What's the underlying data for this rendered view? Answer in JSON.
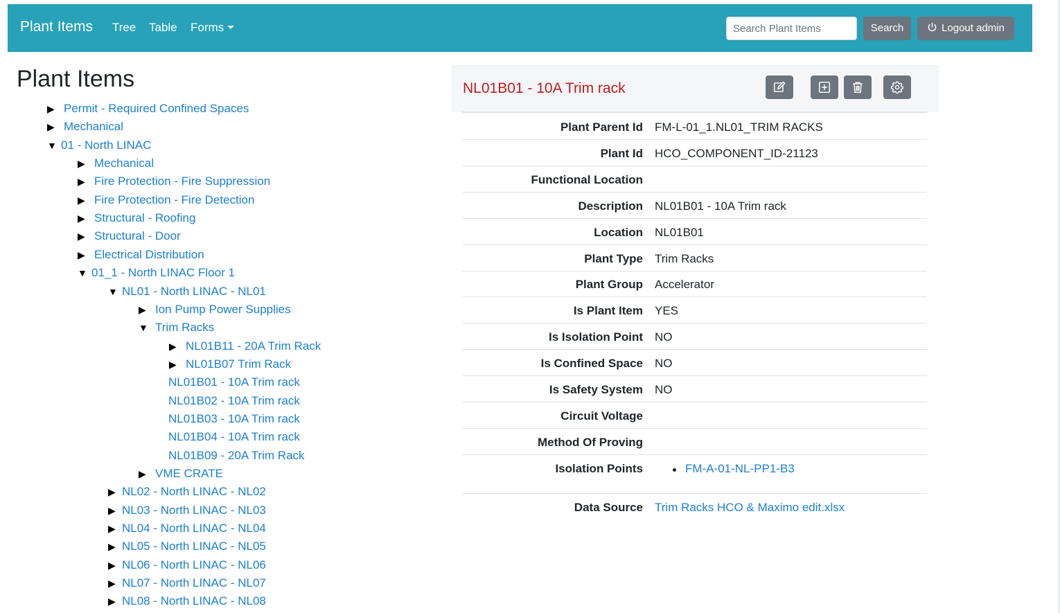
{
  "navbar": {
    "brand": "Plant Items",
    "links": [
      "Tree",
      "Table",
      "Forms"
    ],
    "search_placeholder": "Search Plant Items",
    "search_button": "Search",
    "logout_button": "Logout admin",
    "color": "#27a2b8"
  },
  "page_title": "Plant Items",
  "tree": {
    "items": [
      {
        "label": "Permit - Required Confined Spaces",
        "level": 0,
        "state": "collapsed"
      },
      {
        "label": "Mechanical",
        "level": 0,
        "state": "collapsed"
      },
      {
        "label": "01 - North LINAC",
        "level": 0,
        "state": "expanded"
      },
      {
        "label": "Mechanical",
        "level": 1,
        "state": "collapsed"
      },
      {
        "label": "Fire Protection - Fire Suppression",
        "level": 1,
        "state": "collapsed"
      },
      {
        "label": "Fire Protection - Fire Detection",
        "level": 1,
        "state": "collapsed"
      },
      {
        "label": "Structural - Roofing",
        "level": 1,
        "state": "collapsed"
      },
      {
        "label": "Structural - Door",
        "level": 1,
        "state": "collapsed"
      },
      {
        "label": "Electrical Distribution",
        "level": 1,
        "state": "collapsed"
      },
      {
        "label": "01_1 - North LINAC Floor 1",
        "level": 1,
        "state": "expanded"
      },
      {
        "label": "NL01 - North LINAC - NL01",
        "level": 2,
        "state": "expanded"
      },
      {
        "label": "Ion Pump Power Supplies",
        "level": 3,
        "state": "collapsed"
      },
      {
        "label": "Trim Racks",
        "level": 3,
        "state": "expanded"
      },
      {
        "label": "NL01B11 - 20A Trim Rack",
        "level": 4,
        "state": "collapsed"
      },
      {
        "label": "NL01B07 Trim Rack",
        "level": 4,
        "state": "collapsed"
      },
      {
        "label": "NL01B01 - 10A Trim rack",
        "level": 4,
        "state": "leaf"
      },
      {
        "label": "NL01B02 - 10A Trim rack",
        "level": 4,
        "state": "leaf"
      },
      {
        "label": "NL01B03 - 10A Trim rack",
        "level": 4,
        "state": "leaf"
      },
      {
        "label": "NL01B04 - 10A Trim rack",
        "level": 4,
        "state": "leaf"
      },
      {
        "label": "NL01B09 - 20A Trim Rack",
        "level": 4,
        "state": "leaf"
      },
      {
        "label": "VME CRATE",
        "level": 3,
        "state": "collapsed"
      },
      {
        "label": "NL02 - North LINAC - NL02",
        "level": 2,
        "state": "collapsed"
      },
      {
        "label": "NL03 - North LINAC - NL03",
        "level": 2,
        "state": "collapsed"
      },
      {
        "label": "NL04 - North LINAC - NL04",
        "level": 2,
        "state": "collapsed"
      },
      {
        "label": "NL05 - North LINAC - NL05",
        "level": 2,
        "state": "collapsed"
      },
      {
        "label": "NL06 - North LINAC - NL06",
        "level": 2,
        "state": "collapsed"
      },
      {
        "label": "NL07 - North LINAC - NL07",
        "level": 2,
        "state": "collapsed"
      },
      {
        "label": "NL08 - North LINAC - NL08",
        "level": 2,
        "state": "collapsed"
      }
    ]
  },
  "detail": {
    "title": "NL01B01 - 10A Trim rack",
    "title_color": "#c11a1f",
    "actions": [
      "edit-icon",
      "add-icon",
      "trash-icon",
      "gear-icon"
    ],
    "rows": [
      {
        "label": "Plant Parent Id",
        "value": "FM-L-01_1.NL01_TRIM RACKS"
      },
      {
        "label": "Plant Id",
        "value": "HCO_COMPONENT_ID-21123"
      },
      {
        "label": "Functional Location",
        "value": ""
      },
      {
        "label": "Description",
        "value": "NL01B01 - 10A Trim rack"
      },
      {
        "label": "Location",
        "value": "NL01B01"
      },
      {
        "label": "Plant Type",
        "value": "Trim Racks"
      },
      {
        "label": "Plant Group",
        "value": "Accelerator"
      },
      {
        "label": "Is Plant Item",
        "value": "YES"
      },
      {
        "label": "Is Isolation Point",
        "value": "NO"
      },
      {
        "label": "Is Confined Space",
        "value": "NO"
      },
      {
        "label": "Is Safety System",
        "value": "NO"
      },
      {
        "label": "Circuit Voltage",
        "value": ""
      },
      {
        "label": "Method Of Proving",
        "value": ""
      }
    ],
    "isolation_points_label": "Isolation Points",
    "isolation_points": [
      "FM-A-01-NL-PP1-B3"
    ],
    "data_source_label": "Data Source",
    "data_source": "Trim Racks HCO & Maximo edit.xlsx"
  }
}
